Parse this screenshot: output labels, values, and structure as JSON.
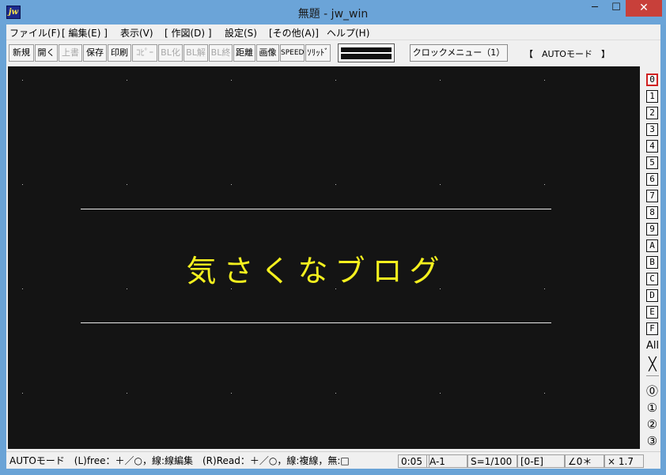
{
  "window": {
    "title": "無題 - jw_win",
    "icon_text": "jw",
    "minimize_glyph": "─",
    "maximize_glyph": "☐",
    "close_glyph": "✕"
  },
  "menu": [
    "ファイル(F)",
    "[ 編集(E) ]",
    "表示(V)",
    "[ 作図(D) ]",
    "設定(S)",
    "[その他(A)]",
    "ヘルプ(H)"
  ],
  "toolbar": {
    "buttons": [
      "新規",
      "開く",
      "上書",
      "保存",
      "印刷",
      "ｺﾋﾟｰ",
      "BL化",
      "BL解",
      "BL終",
      "距離",
      "画像",
      "SPEED",
      "ｿﾘｯﾄﾞ"
    ],
    "clock_menu": "クロックメニュー（1）",
    "mode_label": "【　AUTOモード　】"
  },
  "canvas": {
    "text": "気さくなブログ",
    "text_color": "#f4f01e",
    "background": "#141414"
  },
  "layers": {
    "buttons": [
      "0",
      "1",
      "2",
      "3",
      "4",
      "5",
      "6",
      "7",
      "8",
      "9",
      "A",
      "B",
      "C",
      "D",
      "E",
      "F"
    ],
    "active": "0",
    "all_label": "All",
    "close_glyph": "╳",
    "group_buttons": [
      "⓪",
      "①",
      "②",
      "③"
    ]
  },
  "status": {
    "hint": "AUTOモード　(L)free：＋／○，線:線編集　(R)Read：＋／○，線:複線，無:□",
    "paper": "0:05",
    "size": "A-1",
    "scale": "S=1/100",
    "layer_group": "[0-E]",
    "angle": "∠0＊",
    "factor": "×  1.7"
  }
}
